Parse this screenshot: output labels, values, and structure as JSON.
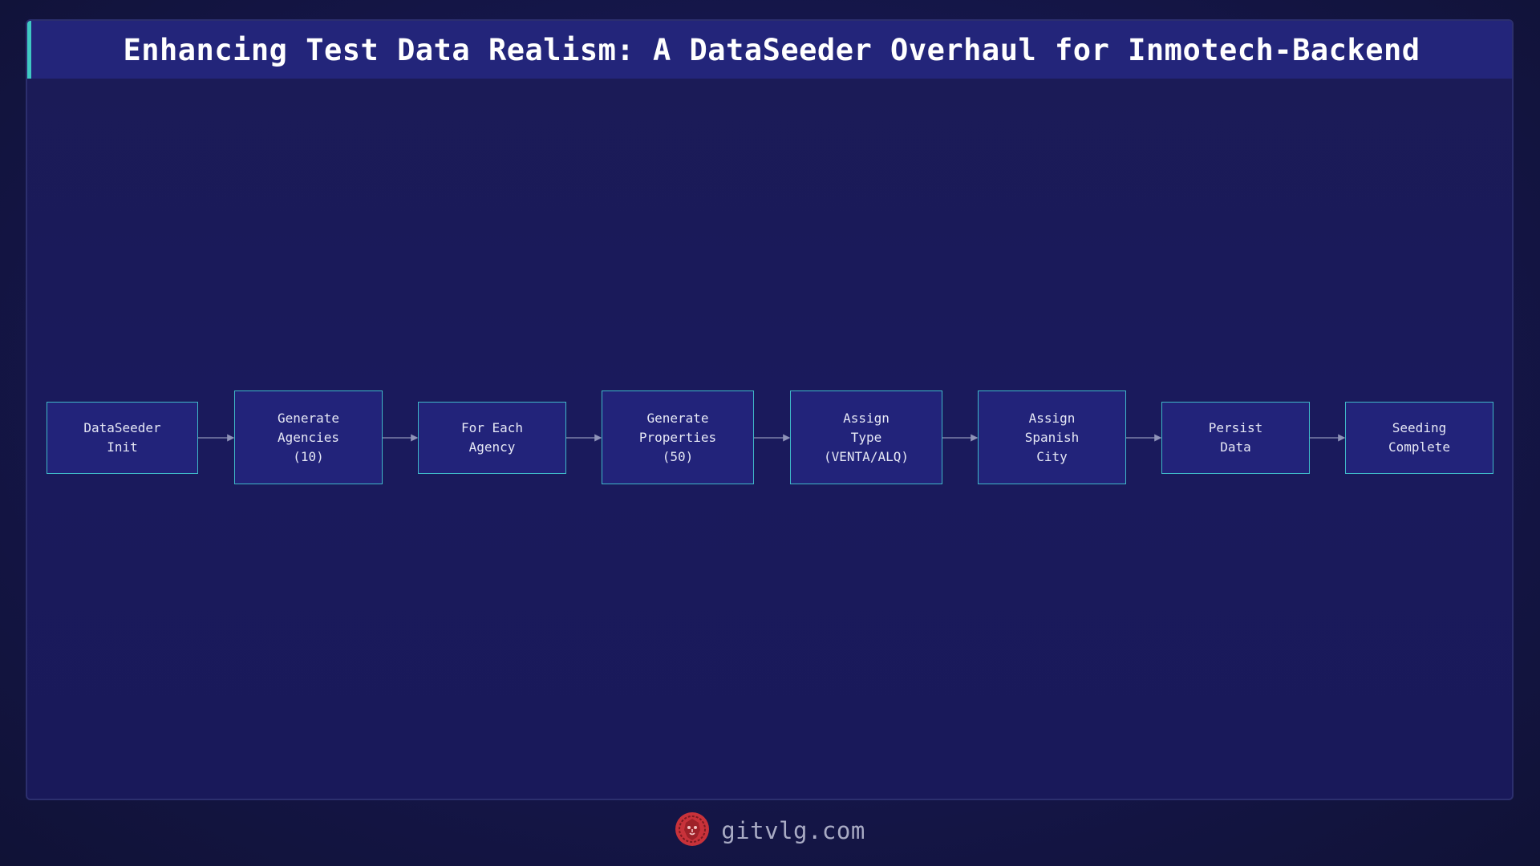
{
  "header": {
    "title": "Enhancing Test Data Realism: A DataSeeder Overhaul for Inmotech-Backend"
  },
  "diagram": {
    "nodes": [
      {
        "id": "n1",
        "label": "DataSeeder\nInit"
      },
      {
        "id": "n2",
        "label": "Generate\nAgencies\n(10)"
      },
      {
        "id": "n3",
        "label": "For Each\nAgency"
      },
      {
        "id": "n4",
        "label": "Generate\nProperties\n(50)"
      },
      {
        "id": "n5",
        "label": "Assign\nType\n(VENTA/ALQ)"
      },
      {
        "id": "n6",
        "label": "Assign\nSpanish\nCity"
      },
      {
        "id": "n7",
        "label": "Persist\nData"
      },
      {
        "id": "n8",
        "label": "Seeding\nComplete"
      }
    ],
    "edges": [
      {
        "from": "n1",
        "to": "n2"
      },
      {
        "from": "n2",
        "to": "n3"
      },
      {
        "from": "n3",
        "to": "n4"
      },
      {
        "from": "n4",
        "to": "n5"
      },
      {
        "from": "n5",
        "to": "n6"
      },
      {
        "from": "n6",
        "to": "n7"
      },
      {
        "from": "n7",
        "to": "n8"
      }
    ]
  },
  "footer": {
    "site": "gitvlg.com",
    "logo_icon": "lion-head-icon"
  },
  "colors": {
    "background": "#15164a",
    "panel": "#1b1b56",
    "title_bar": "#23257a",
    "accent": "#3fc9c3",
    "node_fill": "#22237a",
    "node_border": "#3fb8c8",
    "edge": "#8f93b8",
    "logo": "#c8323a"
  }
}
